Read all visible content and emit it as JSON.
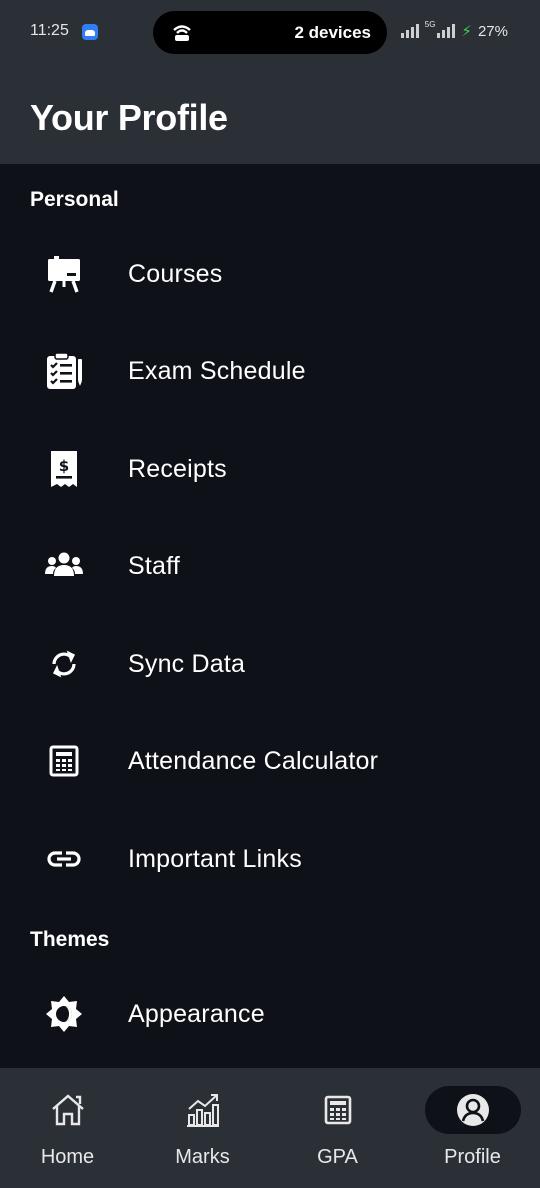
{
  "status_bar": {
    "time": "11:25",
    "hotspot_label": "2 devices",
    "network_tag": "5G",
    "battery": "27%"
  },
  "header": {
    "title": "Your Profile"
  },
  "sections": {
    "personal": "Personal",
    "themes": "Themes"
  },
  "menu": {
    "courses": "Courses",
    "exam_schedule": "Exam Schedule",
    "receipts": "Receipts",
    "staff": "Staff",
    "sync_data": "Sync Data",
    "attendance_calculator": "Attendance Calculator",
    "important_links": "Important Links",
    "appearance": "Appearance"
  },
  "icons": {
    "courses": "presentation-board-icon",
    "exam_schedule": "clipboard-checklist-icon",
    "receipts": "receipt-dollar-icon",
    "staff": "people-group-icon",
    "sync_data": "sync-arrows-icon",
    "attendance_calculator": "calculator-icon",
    "important_links": "link-icon",
    "appearance": "brightness-icon"
  },
  "bottom_nav": {
    "active": "Profile",
    "items": [
      {
        "label": "Home",
        "icon": "home-icon"
      },
      {
        "label": "Marks",
        "icon": "bar-chart-icon"
      },
      {
        "label": "GPA",
        "icon": "calculator-icon"
      },
      {
        "label": "Profile",
        "icon": "user-circle-icon"
      }
    ]
  },
  "colors": {
    "background": "#0e1118",
    "header": "#2b2f36",
    "text": "#ffffff",
    "battery_bolt": "#3ecf5a"
  }
}
